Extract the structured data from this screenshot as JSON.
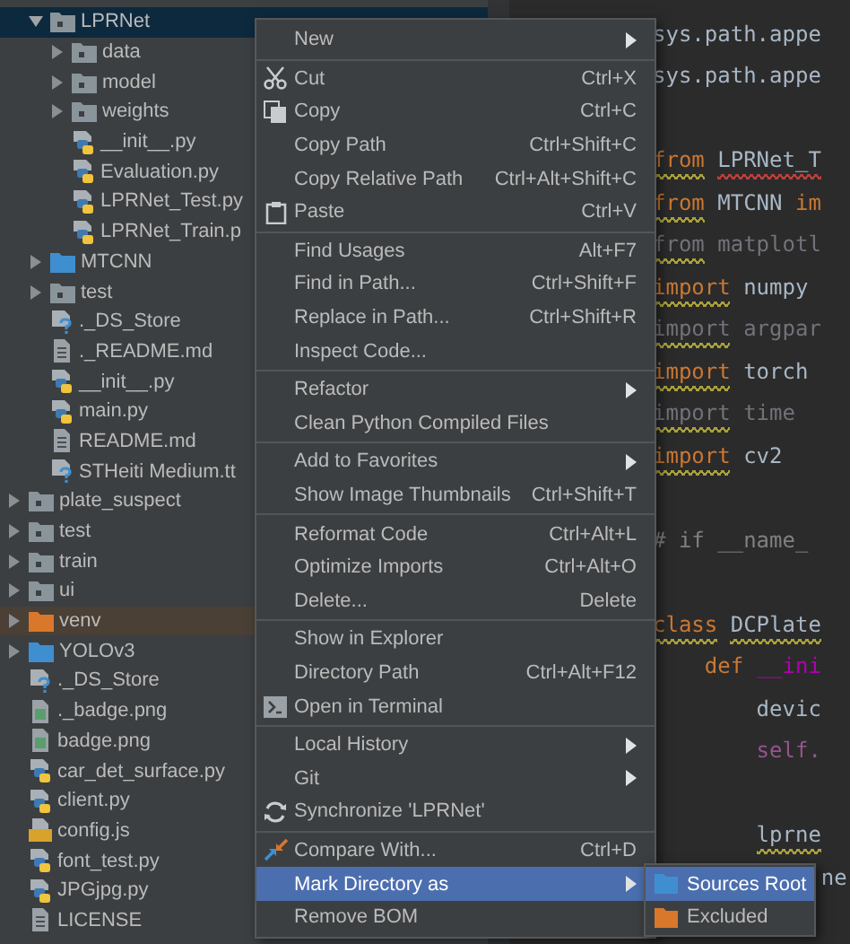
{
  "project_tree": [
    {
      "children": [
        {
          "kind": "folder",
          "label": "LPRNet",
          "expanded": true,
          "selected": true,
          "children": [
            {
              "kind": "folder",
              "label": "data",
              "expanded": false,
              "selected": false
            },
            {
              "kind": "folder",
              "label": "model",
              "expanded": false,
              "selected": false
            },
            {
              "kind": "folder",
              "label": "weights",
              "expanded": false,
              "selected": false
            },
            {
              "kind": "python",
              "label": "__init__.py",
              "selected": false
            },
            {
              "kind": "python",
              "label": "Evaluation.py",
              "selected": false
            },
            {
              "kind": "python",
              "label": "LPRNet_Test.py",
              "selected": false
            },
            {
              "kind": "python",
              "label": "LPRNet_Train.p",
              "selected": false
            }
          ]
        },
        {
          "kind": "source_folder",
          "label": "MTCNN",
          "expanded": false,
          "selected": false
        },
        {
          "kind": "folder",
          "label": "test",
          "expanded": false,
          "selected": false
        },
        {
          "kind": "unknown",
          "label": "._DS_Store",
          "selected": false
        },
        {
          "kind": "text",
          "label": "._README.md",
          "selected": false
        },
        {
          "kind": "python",
          "label": "__init__.py",
          "selected": false
        },
        {
          "kind": "python",
          "label": "main.py",
          "selected": false
        },
        {
          "kind": "text",
          "label": "README.md",
          "selected": false
        },
        {
          "kind": "unknown",
          "label": "STHeiti Medium.tt",
          "selected": false
        }
      ]
    },
    {
      "kind": "folder",
      "label": "plate_suspect",
      "expanded": false,
      "selected": false
    },
    {
      "kind": "folder",
      "label": "test",
      "expanded": false,
      "selected": false
    },
    {
      "kind": "folder",
      "label": "train",
      "expanded": false,
      "selected": false
    },
    {
      "kind": "folder",
      "label": "ui",
      "expanded": false,
      "selected": false
    },
    {
      "kind": "excluded_folder",
      "label": "venv",
      "expanded": false,
      "selected": false
    },
    {
      "kind": "source_folder",
      "label": "YOLOv3",
      "expanded": false,
      "selected": false
    },
    {
      "kind": "unknown",
      "label": "._DS_Store",
      "selected": false
    },
    {
      "kind": "image",
      "label": "._badge.png",
      "selected": false
    },
    {
      "kind": "image",
      "label": "badge.png",
      "selected": false
    },
    {
      "kind": "python",
      "label": "car_det_surface.py",
      "selected": false
    },
    {
      "kind": "python",
      "label": "client.py",
      "selected": false
    },
    {
      "kind": "javascript",
      "label": "config.js",
      "selected": false
    },
    {
      "kind": "python",
      "label": "font_test.py",
      "selected": false
    },
    {
      "kind": "python",
      "label": "JPGjpg.py",
      "selected": false
    },
    {
      "kind": "text",
      "label": "LICENSE",
      "selected": false
    }
  ],
  "editor": {
    "lines": [
      {
        "kind": "code",
        "tokens": [
          {
            "text": "sys.path.appe",
            "kind": "plain"
          }
        ]
      },
      {
        "kind": "code",
        "tokens": [
          {
            "text": "sys.path.appe",
            "kind": "plain"
          }
        ]
      },
      {
        "kind": "blank"
      },
      {
        "kind": "code",
        "tokens": [
          {
            "text": "from",
            "kind": "keyword",
            "squiggle": {
              "color": "#a9a13a"
            }
          },
          {
            "text": "LPRNet_T",
            "kind": "plain",
            "squiggle": {
              "color": "#bc3f3c"
            }
          }
        ]
      },
      {
        "kind": "code",
        "tokens": [
          {
            "text": "from",
            "kind": "keyword",
            "squiggle": {
              "color": "#a9a13a"
            }
          },
          {
            "text": "MTCNN",
            "kind": "plain"
          },
          {
            "text": "im",
            "kind": "keyword"
          }
        ]
      },
      {
        "kind": "code",
        "tokens": [
          {
            "text": "from",
            "kind": "unused",
            "squiggle": {
              "color": "#a9a13a"
            }
          },
          {
            "text": "matplotl",
            "kind": "unused"
          }
        ]
      },
      {
        "kind": "code",
        "tokens": [
          {
            "text": "import",
            "kind": "keyword",
            "squiggle": {
              "color": "#a9a13a"
            }
          },
          {
            "text": "numpy",
            "kind": "plain"
          }
        ]
      },
      {
        "kind": "code",
        "tokens": [
          {
            "text": "import",
            "kind": "unused",
            "squiggle": {
              "color": "#a9a13a"
            }
          },
          {
            "text": "argpar",
            "kind": "unused"
          }
        ]
      },
      {
        "kind": "code",
        "tokens": [
          {
            "text": "import",
            "kind": "keyword",
            "squiggle": {
              "color": "#a9a13a"
            }
          },
          {
            "text": "torch",
            "kind": "plain"
          }
        ]
      },
      {
        "kind": "code",
        "tokens": [
          {
            "text": "import",
            "kind": "unused",
            "squiggle": {
              "color": "#a9a13a"
            }
          },
          {
            "text": "time",
            "kind": "unused"
          }
        ]
      },
      {
        "kind": "code",
        "tokens": [
          {
            "text": "import",
            "kind": "keyword",
            "squiggle": {
              "color": "#a9a13a"
            }
          },
          {
            "text": "cv2",
            "kind": "plain"
          }
        ]
      },
      {
        "kind": "blank"
      },
      {
        "kind": "code",
        "tokens": [
          {
            "text": "# if __name_",
            "kind": "comment"
          }
        ]
      },
      {
        "kind": "blank"
      },
      {
        "kind": "code",
        "tokens": [
          {
            "text": "class",
            "kind": "keyword",
            "squiggle": {
              "color": "#a9a13a"
            }
          },
          {
            "text": "DCPlate",
            "kind": "plain",
            "squiggle": {
              "color": "#a9a13a"
            }
          }
        ]
      },
      {
        "kind": "code",
        "tokens": [
          {
            "text": "    def",
            "kind": "keyword"
          },
          {
            "text": "__ini",
            "kind": "dunder"
          }
        ]
      },
      {
        "kind": "code",
        "tokens": [
          {
            "text": "        devic",
            "kind": "plain"
          }
        ]
      },
      {
        "kind": "code",
        "tokens": [
          {
            "text": "        self.",
            "kind": "self"
          }
        ]
      },
      {
        "kind": "blank"
      },
      {
        "kind": "code",
        "tokens": [
          {
            "text": "        lprne",
            "kind": "plain",
            "squiggle": {
              "color": "#a9a13a"
            }
          }
        ]
      },
      {
        "kind": "code",
        "tokens": [
          {
            "text": "             ne",
            "kind": "plain"
          }
        ]
      }
    ]
  },
  "context_menu": {
    "items": [
      {
        "kind": "plain",
        "label": "New",
        "submenu_arrow": true,
        "selected": false
      },
      {
        "kind": "separator"
      },
      {
        "kind": "cut",
        "label": "Cut",
        "shortcut": "Ctrl+X",
        "submenu_arrow": false,
        "selected": false
      },
      {
        "kind": "copy",
        "label": "Copy",
        "shortcut": "Ctrl+C",
        "submenu_arrow": false,
        "selected": false
      },
      {
        "kind": "plain",
        "label": "Copy Path",
        "shortcut": "Ctrl+Shift+C",
        "submenu_arrow": false,
        "selected": false
      },
      {
        "kind": "plain",
        "label": "Copy Relative Path",
        "shortcut": "Ctrl+Alt+Shift+C",
        "submenu_arrow": false,
        "selected": false
      },
      {
        "kind": "paste",
        "label": "Paste",
        "shortcut": "Ctrl+V",
        "submenu_arrow": false,
        "selected": false
      },
      {
        "kind": "separator"
      },
      {
        "kind": "plain",
        "label": "Find Usages",
        "shortcut": "Alt+F7",
        "submenu_arrow": false,
        "selected": false
      },
      {
        "kind": "plain",
        "label": "Find in Path...",
        "shortcut": "Ctrl+Shift+F",
        "submenu_arrow": false,
        "selected": false
      },
      {
        "kind": "plain",
        "label": "Replace in Path...",
        "shortcut": "Ctrl+Shift+R",
        "submenu_arrow": false,
        "selected": false
      },
      {
        "kind": "plain",
        "label": "Inspect Code...",
        "submenu_arrow": false,
        "selected": false
      },
      {
        "kind": "separator"
      },
      {
        "kind": "plain",
        "label": "Refactor",
        "submenu_arrow": true,
        "selected": false
      },
      {
        "kind": "plain",
        "label": "Clean Python Compiled Files",
        "submenu_arrow": false,
        "selected": false
      },
      {
        "kind": "separator"
      },
      {
        "kind": "plain",
        "label": "Add to Favorites",
        "submenu_arrow": true,
        "selected": false
      },
      {
        "kind": "plain",
        "label": "Show Image Thumbnails",
        "shortcut": "Ctrl+Shift+T",
        "submenu_arrow": false,
        "selected": false
      },
      {
        "kind": "separator"
      },
      {
        "kind": "plain",
        "label": "Reformat Code",
        "shortcut": "Ctrl+Alt+L",
        "submenu_arrow": false,
        "selected": false
      },
      {
        "kind": "plain",
        "label": "Optimize Imports",
        "shortcut": "Ctrl+Alt+O",
        "submenu_arrow": false,
        "selected": false
      },
      {
        "kind": "plain",
        "label": "Delete...",
        "shortcut": "Delete",
        "submenu_arrow": false,
        "selected": false
      },
      {
        "kind": "separator"
      },
      {
        "kind": "plain",
        "label": "Show in Explorer",
        "submenu_arrow": false,
        "selected": false
      },
      {
        "kind": "plain",
        "label": "Directory Path",
        "shortcut": "Ctrl+Alt+F12",
        "submenu_arrow": false,
        "selected": false
      },
      {
        "kind": "terminal",
        "label": "Open in Terminal",
        "submenu_arrow": false,
        "selected": false
      },
      {
        "kind": "separator"
      },
      {
        "kind": "plain",
        "label": "Local History",
        "submenu_arrow": true,
        "selected": false
      },
      {
        "kind": "plain",
        "label": "Git",
        "submenu_arrow": true,
        "selected": false
      },
      {
        "kind": "sync",
        "label": "Synchronize 'LPRNet'",
        "submenu_arrow": false,
        "selected": false
      },
      {
        "kind": "separator"
      },
      {
        "kind": "compare",
        "label": "Compare With...",
        "shortcut": "Ctrl+D",
        "submenu_arrow": false,
        "selected": false
      },
      {
        "kind": "plain",
        "label": "Mark Directory as",
        "submenu_arrow": true,
        "selected": true,
        "submenu": [
          {
            "kind": "source_folder",
            "label": "Sources Root",
            "selected": true
          },
          {
            "kind": "excluded_folder",
            "label": "Excluded",
            "selected": false
          }
        ]
      },
      {
        "kind": "plain",
        "label": "Remove BOM",
        "submenu_arrow": false,
        "selected": false
      }
    ]
  }
}
